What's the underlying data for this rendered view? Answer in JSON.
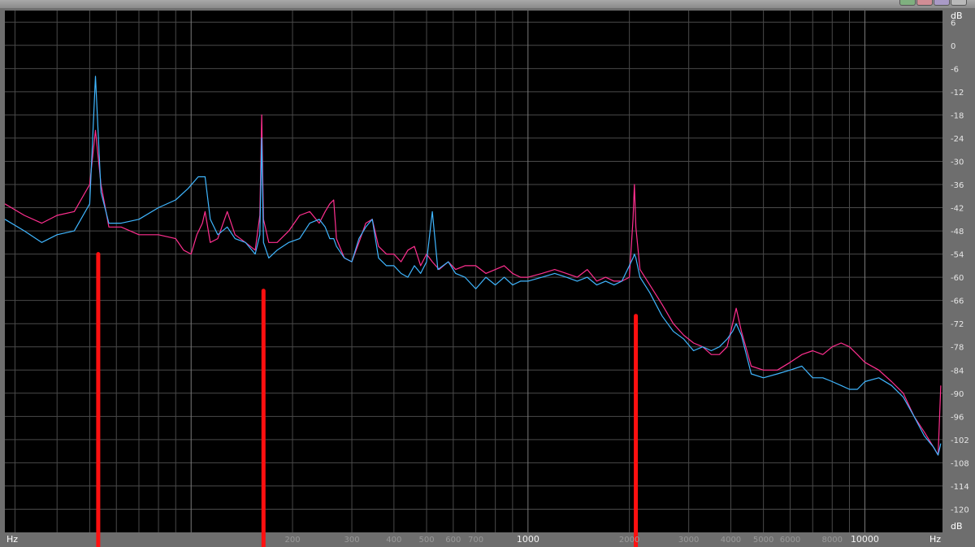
{
  "chart_data": {
    "type": "line",
    "xscale": "log",
    "xlim": [
      28,
      17000
    ],
    "ylim": [
      -126,
      9
    ],
    "grid": true,
    "x_unit_left": "Hz",
    "x_unit_right": "Hz",
    "y_unit_top": "dB",
    "y_unit_bottom": "dB",
    "y_ticks": [
      6,
      0,
      -6,
      -12,
      -18,
      -24,
      -30,
      -36,
      -42,
      -48,
      -54,
      -60,
      -66,
      -72,
      -78,
      -84,
      -90,
      -96,
      -102,
      -108,
      -114,
      -120
    ],
    "x_tick_labels": [
      {
        "value": 200,
        "label": "200",
        "major": false
      },
      {
        "value": 300,
        "label": "300",
        "major": false
      },
      {
        "value": 400,
        "label": "400",
        "major": false
      },
      {
        "value": 500,
        "label": "500",
        "major": false
      },
      {
        "value": 600,
        "label": "600",
        "major": false
      },
      {
        "value": 700,
        "label": "700",
        "major": false
      },
      {
        "value": 1000,
        "label": "1000",
        "major": true
      },
      {
        "value": 2000,
        "label": "2000",
        "major": false
      },
      {
        "value": 3000,
        "label": "3000",
        "major": false
      },
      {
        "value": 4000,
        "label": "4000",
        "major": false
      },
      {
        "value": 5000,
        "label": "5000",
        "major": false
      },
      {
        "value": 6000,
        "label": "6000",
        "major": false
      },
      {
        "value": 8000,
        "label": "8000",
        "major": false
      },
      {
        "value": 10000,
        "label": "10000",
        "major": true
      }
    ],
    "series": [
      {
        "color": "#ff2f8f",
        "points": [
          [
            28,
            -41
          ],
          [
            32,
            -44
          ],
          [
            36,
            -46
          ],
          [
            40,
            -44
          ],
          [
            45,
            -43
          ],
          [
            50,
            -36
          ],
          [
            52,
            -22
          ],
          [
            54,
            -36
          ],
          [
            57,
            -47
          ],
          [
            62,
            -47
          ],
          [
            70,
            -49
          ],
          [
            80,
            -49
          ],
          [
            90,
            -50
          ],
          [
            95,
            -53
          ],
          [
            100,
            -54
          ],
          [
            104,
            -49
          ],
          [
            108,
            -46
          ],
          [
            110,
            -43
          ],
          [
            114,
            -51
          ],
          [
            120,
            -50
          ],
          [
            128,
            -43
          ],
          [
            135,
            -49
          ],
          [
            145,
            -51
          ],
          [
            155,
            -53
          ],
          [
            160,
            -44
          ],
          [
            162,
            -18
          ],
          [
            164,
            -45
          ],
          [
            170,
            -51
          ],
          [
            180,
            -51
          ],
          [
            195,
            -48
          ],
          [
            210,
            -44
          ],
          [
            225,
            -43
          ],
          [
            240,
            -46
          ],
          [
            250,
            -43
          ],
          [
            258,
            -41
          ],
          [
            265,
            -40
          ],
          [
            270,
            -50
          ],
          [
            285,
            -55
          ],
          [
            300,
            -56
          ],
          [
            315,
            -51
          ],
          [
            330,
            -46
          ],
          [
            345,
            -45
          ],
          [
            360,
            -52
          ],
          [
            380,
            -54
          ],
          [
            400,
            -54
          ],
          [
            420,
            -56
          ],
          [
            440,
            -53
          ],
          [
            460,
            -52
          ],
          [
            480,
            -57
          ],
          [
            500,
            -54
          ],
          [
            520,
            -56
          ],
          [
            545,
            -58
          ],
          [
            580,
            -56
          ],
          [
            610,
            -58
          ],
          [
            650,
            -57
          ],
          [
            700,
            -57
          ],
          [
            750,
            -59
          ],
          [
            800,
            -58
          ],
          [
            850,
            -57
          ],
          [
            900,
            -59
          ],
          [
            950,
            -60
          ],
          [
            1000,
            -60
          ],
          [
            1100,
            -59
          ],
          [
            1200,
            -58
          ],
          [
            1300,
            -59
          ],
          [
            1400,
            -60
          ],
          [
            1500,
            -58
          ],
          [
            1600,
            -61
          ],
          [
            1700,
            -60
          ],
          [
            1800,
            -61
          ],
          [
            1900,
            -61
          ],
          [
            2000,
            -60
          ],
          [
            2050,
            -45
          ],
          [
            2070,
            -36
          ],
          [
            2090,
            -47
          ],
          [
            2150,
            -58
          ],
          [
            2300,
            -62
          ],
          [
            2500,
            -67
          ],
          [
            2700,
            -72
          ],
          [
            2900,
            -75
          ],
          [
            3100,
            -77
          ],
          [
            3300,
            -78
          ],
          [
            3500,
            -80
          ],
          [
            3700,
            -80
          ],
          [
            3900,
            -78
          ],
          [
            4050,
            -72
          ],
          [
            4150,
            -68
          ],
          [
            4300,
            -74
          ],
          [
            4600,
            -83
          ],
          [
            5000,
            -84
          ],
          [
            5500,
            -84
          ],
          [
            6000,
            -82
          ],
          [
            6500,
            -80
          ],
          [
            7000,
            -79
          ],
          [
            7500,
            -80
          ],
          [
            8000,
            -78
          ],
          [
            8500,
            -77
          ],
          [
            9000,
            -78
          ],
          [
            9500,
            -80
          ],
          [
            10000,
            -82
          ],
          [
            11000,
            -84
          ],
          [
            12000,
            -87
          ],
          [
            13000,
            -90
          ],
          [
            14000,
            -96
          ],
          [
            15000,
            -100
          ],
          [
            16000,
            -104
          ],
          [
            16500,
            -106
          ],
          [
            16800,
            -88
          ]
        ]
      },
      {
        "color": "#3fb6ff",
        "points": [
          [
            28,
            -45
          ],
          [
            32,
            -48
          ],
          [
            36,
            -51
          ],
          [
            40,
            -49
          ],
          [
            45,
            -48
          ],
          [
            50,
            -41
          ],
          [
            52,
            -8
          ],
          [
            54,
            -38
          ],
          [
            57,
            -46
          ],
          [
            62,
            -46
          ],
          [
            70,
            -45
          ],
          [
            80,
            -42
          ],
          [
            90,
            -40
          ],
          [
            98,
            -37
          ],
          [
            105,
            -34
          ],
          [
            110,
            -34
          ],
          [
            114,
            -45
          ],
          [
            120,
            -49
          ],
          [
            128,
            -47
          ],
          [
            135,
            -50
          ],
          [
            145,
            -51
          ],
          [
            155,
            -54
          ],
          [
            160,
            -49
          ],
          [
            162,
            -24
          ],
          [
            164,
            -51
          ],
          [
            170,
            -55
          ],
          [
            180,
            -53
          ],
          [
            195,
            -51
          ],
          [
            210,
            -50
          ],
          [
            225,
            -46
          ],
          [
            240,
            -45
          ],
          [
            250,
            -47
          ],
          [
            258,
            -50
          ],
          [
            265,
            -50
          ],
          [
            270,
            -52
          ],
          [
            285,
            -55
          ],
          [
            300,
            -56
          ],
          [
            315,
            -50
          ],
          [
            330,
            -47
          ],
          [
            345,
            -45
          ],
          [
            360,
            -55
          ],
          [
            380,
            -57
          ],
          [
            400,
            -57
          ],
          [
            420,
            -59
          ],
          [
            440,
            -60
          ],
          [
            460,
            -57
          ],
          [
            480,
            -59
          ],
          [
            500,
            -56
          ],
          [
            520,
            -43
          ],
          [
            540,
            -58
          ],
          [
            580,
            -56
          ],
          [
            610,
            -59
          ],
          [
            650,
            -60
          ],
          [
            700,
            -63
          ],
          [
            750,
            -60
          ],
          [
            800,
            -62
          ],
          [
            850,
            -60
          ],
          [
            900,
            -62
          ],
          [
            950,
            -61
          ],
          [
            1000,
            -61
          ],
          [
            1100,
            -60
          ],
          [
            1200,
            -59
          ],
          [
            1300,
            -60
          ],
          [
            1400,
            -61
          ],
          [
            1500,
            -60
          ],
          [
            1600,
            -62
          ],
          [
            1700,
            -61
          ],
          [
            1800,
            -62
          ],
          [
            1900,
            -61
          ],
          [
            2000,
            -57
          ],
          [
            2050,
            -55
          ],
          [
            2070,
            -54
          ],
          [
            2090,
            -55
          ],
          [
            2150,
            -60
          ],
          [
            2300,
            -64
          ],
          [
            2500,
            -70
          ],
          [
            2700,
            -74
          ],
          [
            2900,
            -76
          ],
          [
            3100,
            -79
          ],
          [
            3300,
            -78
          ],
          [
            3500,
            -79
          ],
          [
            3700,
            -78
          ],
          [
            3900,
            -76
          ],
          [
            4050,
            -74
          ],
          [
            4150,
            -72
          ],
          [
            4300,
            -75
          ],
          [
            4600,
            -85
          ],
          [
            5000,
            -86
          ],
          [
            5500,
            -85
          ],
          [
            6000,
            -84
          ],
          [
            6500,
            -83
          ],
          [
            7000,
            -86
          ],
          [
            7500,
            -86
          ],
          [
            8000,
            -87
          ],
          [
            8500,
            -88
          ],
          [
            9000,
            -89
          ],
          [
            9500,
            -89
          ],
          [
            10000,
            -87
          ],
          [
            11000,
            -86
          ],
          [
            12000,
            -88
          ],
          [
            13000,
            -91
          ],
          [
            14000,
            -96
          ],
          [
            15000,
            -101
          ],
          [
            16000,
            -104
          ],
          [
            16500,
            -106
          ],
          [
            16800,
            -103
          ]
        ]
      }
    ],
    "markers": [
      {
        "x": 53,
        "y_top": -54
      },
      {
        "x": 164,
        "y_top": -63.5
      },
      {
        "x": 2090,
        "y_top": -70
      }
    ]
  },
  "ui": {
    "background": "#000000",
    "grid_color": "#4a4a4a",
    "marker_color": "#ff1010",
    "frame_color": "#6e6e6e"
  }
}
